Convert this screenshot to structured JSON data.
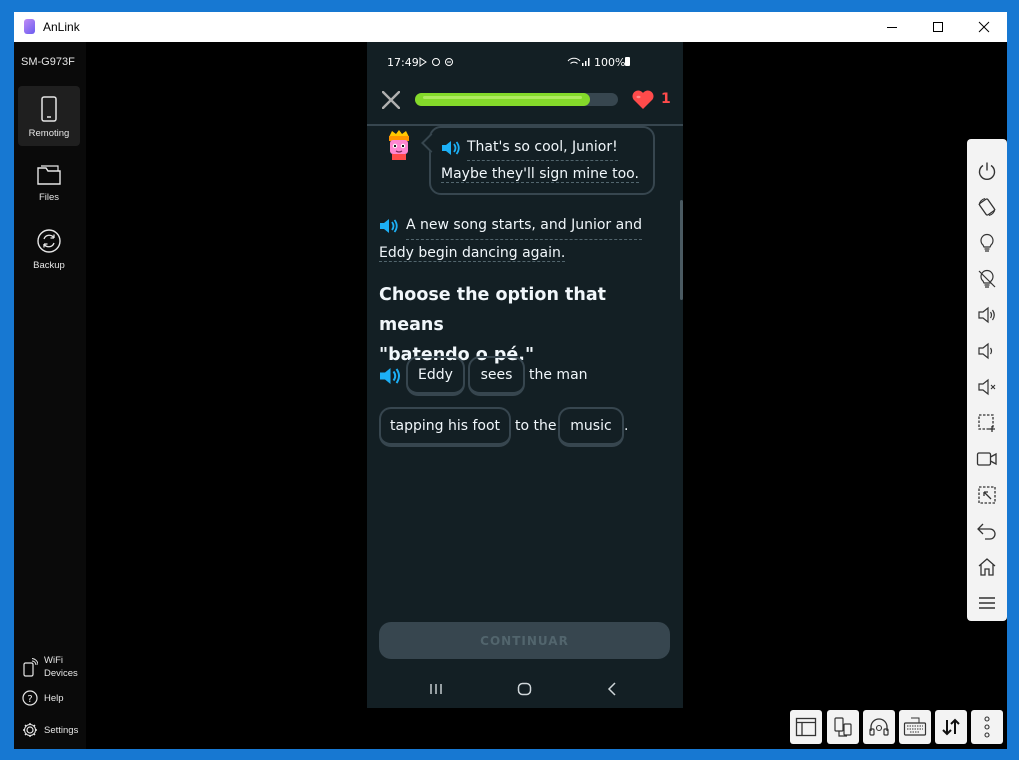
{
  "window": {
    "title": "AnLink"
  },
  "sidebar": {
    "device_name": "SM-G973F",
    "items": [
      {
        "label": "Remoting",
        "icon": "phone-icon"
      },
      {
        "label": "Files",
        "icon": "folder-icon"
      },
      {
        "label": "Backup",
        "icon": "sync-icon"
      }
    ],
    "bottom": [
      {
        "label_line1": "WiFi",
        "label_line2": "Devices",
        "icon": "wifi-phone-icon"
      },
      {
        "label": "Help",
        "icon": "help-icon"
      },
      {
        "label": "Settings",
        "icon": "gear-icon"
      }
    ]
  },
  "phone": {
    "status": {
      "time": "17:49",
      "battery": "100%"
    },
    "progress": 0.86,
    "hearts": "1",
    "bubble": {
      "line1": "That's so cool, Junior!",
      "line2": "Maybe they'll sign mine too."
    },
    "narration": {
      "line1": "A new song starts, and Junior and",
      "line2": "Eddy begin dancing again."
    },
    "question": {
      "line1": "Choose the option that means",
      "line2": "\"batendo o pé.\""
    },
    "sentence": {
      "chip_eddy": "Eddy",
      "chip_sees": "sees",
      "text_the_man": "the man",
      "chip_tapping": "tapping his foot",
      "text_to_the": "to the",
      "chip_music": "music",
      "period": "."
    },
    "continue_label": "CONTINUAR"
  },
  "colors": {
    "accent": "#1cb0f6",
    "progress": "#84d92a",
    "heart": "#ff4b4b",
    "phone_bg": "#131f24"
  }
}
